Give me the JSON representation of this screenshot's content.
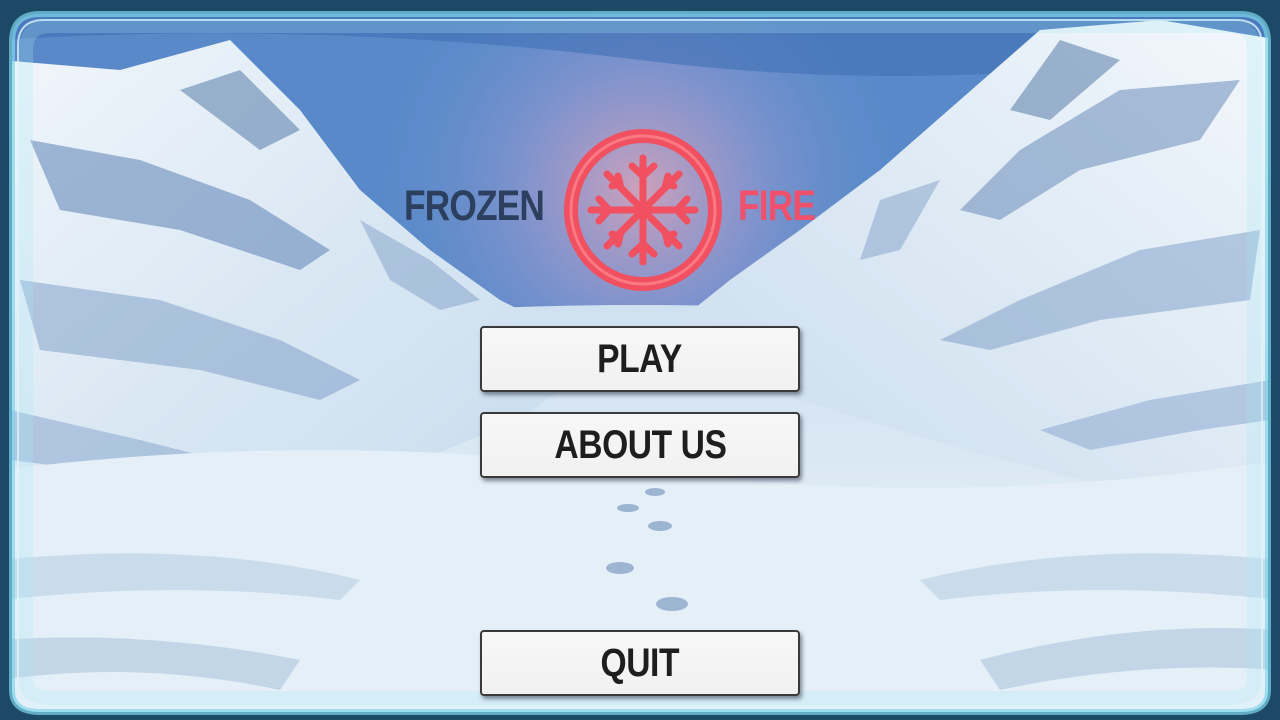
{
  "game": {
    "title_left": "FROZEN",
    "title_right": "FIRE",
    "emblem_icon": "snowflake-ring-icon"
  },
  "menu": {
    "play_label": "PLAY",
    "about_label": "ABOUT US",
    "quit_label": "QUIT"
  },
  "colors": {
    "title_left": "#2c3f5e",
    "title_right": "#f0506a",
    "emblem": "#f05060",
    "button_bg": "#f3f3f3",
    "button_text": "#1e1e1e",
    "sky": "#4c7fc4",
    "snow": "#e6f1f8"
  }
}
